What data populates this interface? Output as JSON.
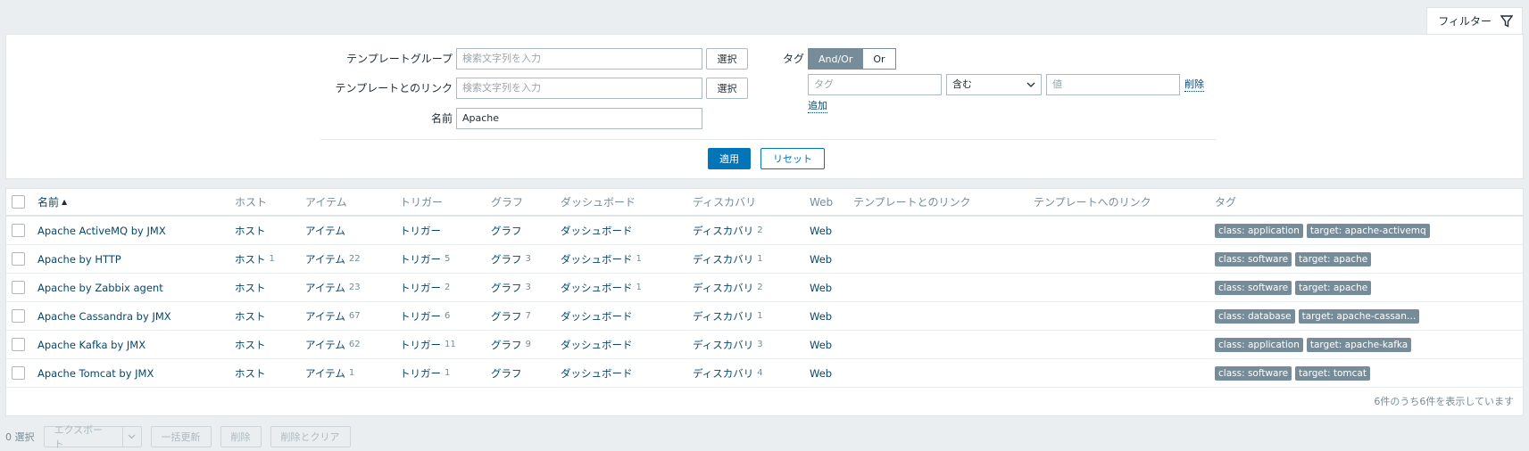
{
  "filter_tab": {
    "label": "フィルター",
    "icon": "funnel-icon"
  },
  "filter": {
    "template_group": {
      "label": "テンプレートグループ",
      "placeholder": "検索文字列を入力",
      "select": "選択"
    },
    "linked_templates": {
      "label": "テンプレートとのリンク",
      "placeholder": "検索文字列を入力",
      "select": "選択"
    },
    "name": {
      "label": "名前",
      "value": "Apache"
    },
    "tags": {
      "label": "タグ",
      "andor": "And/Or",
      "or": "Or",
      "tag_placeholder": "タグ",
      "operator": "含む",
      "value_placeholder": "値",
      "remove": "削除",
      "add": "追加"
    },
    "apply": "適用",
    "reset": "リセット"
  },
  "table": {
    "headers": {
      "name": "名前",
      "hosts": "ホスト",
      "items": "アイテム",
      "triggers": "トリガー",
      "graphs": "グラフ",
      "dashboards": "ダッシュボード",
      "discovery": "ディスカバリ",
      "web": "Web",
      "linked_to": "テンプレートとのリンク",
      "linked_from": "テンプレートへのリンク",
      "tags": "タグ"
    },
    "rows": [
      {
        "name": "Apache ActiveMQ by JMX",
        "hosts": "ホスト",
        "hosts_n": "",
        "items": "アイテム",
        "items_n": "",
        "triggers": "トリガー",
        "triggers_n": "",
        "graphs": "グラフ",
        "graphs_n": "",
        "dashboards": "ダッシュボード",
        "dashboards_n": "",
        "discovery": "ディスカバリ",
        "discovery_n": "2",
        "web": "Web",
        "tag1": "class: application",
        "tag2": "target: apache-activemq"
      },
      {
        "name": "Apache by HTTP",
        "hosts": "ホスト",
        "hosts_n": "1",
        "items": "アイテム",
        "items_n": "22",
        "triggers": "トリガー",
        "triggers_n": "5",
        "graphs": "グラフ",
        "graphs_n": "3",
        "dashboards": "ダッシュボード",
        "dashboards_n": "1",
        "discovery": "ディスカバリ",
        "discovery_n": "1",
        "web": "Web",
        "tag1": "class: software",
        "tag2": "target: apache"
      },
      {
        "name": "Apache by Zabbix agent",
        "hosts": "ホスト",
        "hosts_n": "",
        "items": "アイテム",
        "items_n": "23",
        "triggers": "トリガー",
        "triggers_n": "2",
        "graphs": "グラフ",
        "graphs_n": "3",
        "dashboards": "ダッシュボード",
        "dashboards_n": "1",
        "discovery": "ディスカバリ",
        "discovery_n": "2",
        "web": "Web",
        "tag1": "class: software",
        "tag2": "target: apache"
      },
      {
        "name": "Apache Cassandra by JMX",
        "hosts": "ホスト",
        "hosts_n": "",
        "items": "アイテム",
        "items_n": "67",
        "triggers": "トリガー",
        "triggers_n": "6",
        "graphs": "グラフ",
        "graphs_n": "7",
        "dashboards": "ダッシュボード",
        "dashboards_n": "",
        "discovery": "ディスカバリ",
        "discovery_n": "1",
        "web": "Web",
        "tag1": "class: database",
        "tag2": "target: apache-cassan…"
      },
      {
        "name": "Apache Kafka by JMX",
        "hosts": "ホスト",
        "hosts_n": "",
        "items": "アイテム",
        "items_n": "62",
        "triggers": "トリガー",
        "triggers_n": "11",
        "graphs": "グラフ",
        "graphs_n": "9",
        "dashboards": "ダッシュボード",
        "dashboards_n": "",
        "discovery": "ディスカバリ",
        "discovery_n": "3",
        "web": "Web",
        "tag1": "class: application",
        "tag2": "target: apache-kafka"
      },
      {
        "name": "Apache Tomcat by JMX",
        "hosts": "ホスト",
        "hosts_n": "",
        "items": "アイテム",
        "items_n": "1",
        "triggers": "トリガー",
        "triggers_n": "1",
        "graphs": "グラフ",
        "graphs_n": "",
        "dashboards": "ダッシュボード",
        "dashboards_n": "",
        "discovery": "ディスカバリ",
        "discovery_n": "4",
        "web": "Web",
        "tag1": "class: software",
        "tag2": "target: tomcat"
      }
    ],
    "footer": "6件のうち6件を表示しています"
  },
  "bottom": {
    "selected": "0 選択",
    "export": "エクスポート",
    "mass_update": "一括更新",
    "delete": "削除",
    "delete_clear": "削除とクリア"
  }
}
